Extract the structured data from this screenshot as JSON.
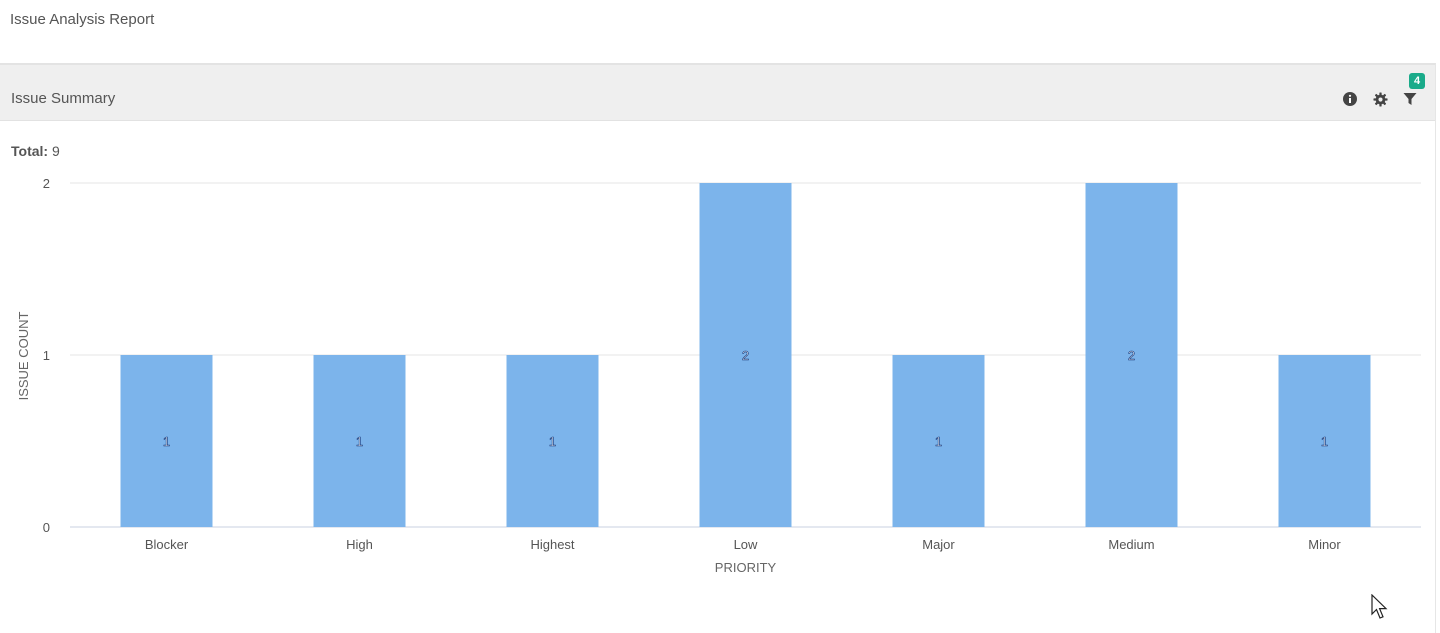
{
  "report": {
    "title": "Issue Analysis Report"
  },
  "panel": {
    "title": "Issue Summary",
    "filter_count": "4",
    "total_label": "Total:",
    "total_value": "9",
    "icons": [
      "info-icon",
      "gear-icon",
      "filter-icon"
    ]
  },
  "chart_data": {
    "type": "bar",
    "categories": [
      "Blocker",
      "High",
      "Highest",
      "Low",
      "Major",
      "Medium",
      "Minor"
    ],
    "values": [
      1,
      1,
      1,
      2,
      1,
      2,
      1
    ],
    "xlabel": "PRIORITY",
    "ylabel": "ISSUE COUNT",
    "ylim": [
      0,
      2
    ],
    "yticks": [
      0,
      1,
      2
    ],
    "grid": true,
    "bar_color": "#7cb4eb",
    "data_labels": true
  }
}
